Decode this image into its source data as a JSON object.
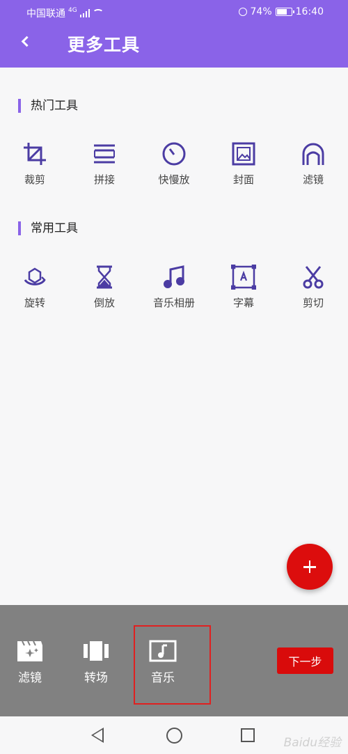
{
  "status_bar": {
    "carrier": "中国联通",
    "network": "4G",
    "battery": "74%",
    "battery_level": 0.74,
    "time": "16:40"
  },
  "header": {
    "title": "更多工具"
  },
  "sections": [
    {
      "title": "热门工具",
      "tools": [
        {
          "label": "裁剪",
          "icon": "crop-icon"
        },
        {
          "label": "拼接",
          "icon": "merge-icon"
        },
        {
          "label": "快慢放",
          "icon": "speed-dial-icon"
        },
        {
          "label": "封面",
          "icon": "cover-image-icon"
        },
        {
          "label": "滤镜",
          "icon": "filter-face-icon"
        }
      ]
    },
    {
      "title": "常用工具",
      "tools": [
        {
          "label": "旋转",
          "icon": "rotate-icon"
        },
        {
          "label": "倒放",
          "icon": "hourglass-icon"
        },
        {
          "label": "音乐相册",
          "icon": "music-note-icon"
        },
        {
          "label": "字幕",
          "icon": "subtitle-icon"
        },
        {
          "label": "剪切",
          "icon": "scissors-icon"
        }
      ]
    }
  ],
  "bottom_bar": {
    "tools": [
      {
        "label": "滤镜",
        "icon": "filter-clapper-icon"
      },
      {
        "label": "转场",
        "icon": "transition-icon"
      },
      {
        "label": "音乐",
        "icon": "music-box-icon"
      }
    ],
    "next_label": "下一步"
  },
  "watermark": "Baidu经验",
  "colors": {
    "accent": "#8a63e8",
    "icon": "#4b3ca3",
    "primary_red": "#dc0d0d",
    "bottom_bar": "#818181"
  }
}
